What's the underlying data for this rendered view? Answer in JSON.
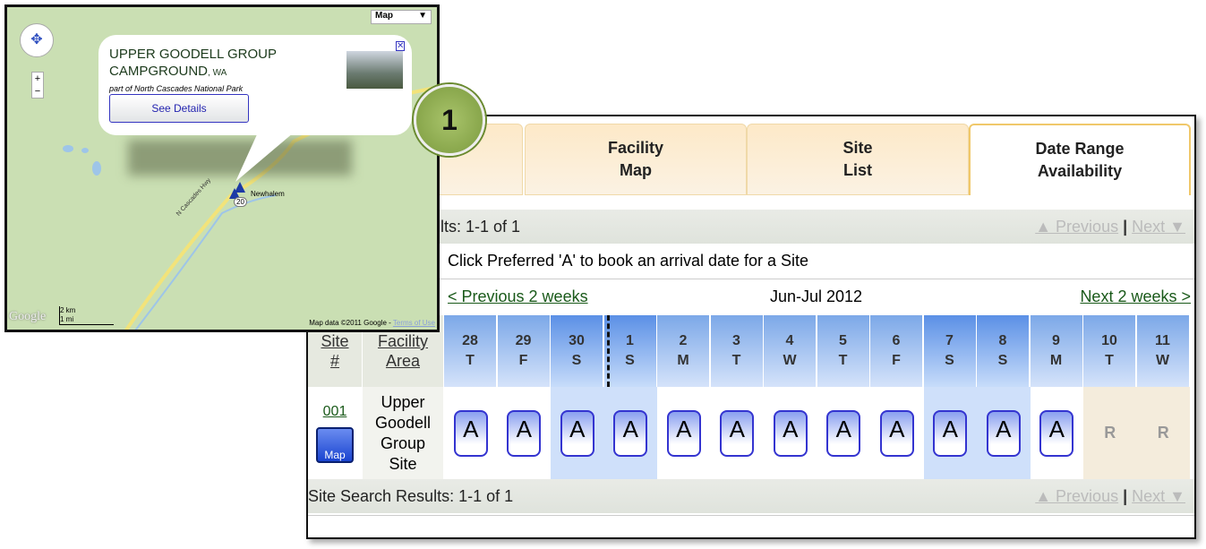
{
  "map": {
    "type_select": "Map",
    "popup": {
      "title_line1": "UPPER GOODELL GROUP",
      "title_line2": "CAMPGROUND",
      "state": ", WA",
      "subtitle": "part of North Cascades National Park",
      "button": "See Details"
    },
    "town": "Newhalem",
    "road": "N Cascades Hwy",
    "route": "20",
    "scale_km": "2 km",
    "scale_mi": "1 mi",
    "logo": "Google",
    "attribution": "Map data ©2011 Google - ",
    "terms": "Terms of Use"
  },
  "callout": "1",
  "tabs": [
    {
      "label": "Facility\nMap"
    },
    {
      "label": "Site\nList"
    },
    {
      "label": "Date Range\nAvailability",
      "active": true
    }
  ],
  "results_top": "lts: 1-1 of 1",
  "results_bottom": "Site Search Results: 1-1 of 1",
  "pager": {
    "previous": "▲ Previous",
    "sep": "|",
    "next": "Next ▼"
  },
  "instruction": "Click Preferred 'A' to book an arrival date for a Site",
  "nav": {
    "prev": "< Previous 2 weeks",
    "month": "Jun-Jul 2012",
    "next": "Next 2 weeks >"
  },
  "columns": {
    "site": "Site\n#",
    "area": "Facility\nArea"
  },
  "days": [
    {
      "d": "28\nT",
      "s": "A"
    },
    {
      "d": "29\nF",
      "s": "A"
    },
    {
      "d": "30\nS",
      "s": "A",
      "we": true
    },
    {
      "d": "1\nS",
      "s": "A",
      "we": true
    },
    {
      "d": "2\nM",
      "s": "A"
    },
    {
      "d": "3\nT",
      "s": "A"
    },
    {
      "d": "4\nW",
      "s": "A"
    },
    {
      "d": "5\nT",
      "s": "A"
    },
    {
      "d": "6\nF",
      "s": "A"
    },
    {
      "d": "7\nS",
      "s": "A",
      "we": true
    },
    {
      "d": "8\nS",
      "s": "A",
      "we": true
    },
    {
      "d": "9\nM",
      "s": "A"
    },
    {
      "d": "10\nT",
      "s": "R"
    },
    {
      "d": "11\nW",
      "s": "R"
    }
  ],
  "site": {
    "number": "001",
    "area": "Upper\nGoodell\nGroup\nSite",
    "map_button": "Map"
  }
}
